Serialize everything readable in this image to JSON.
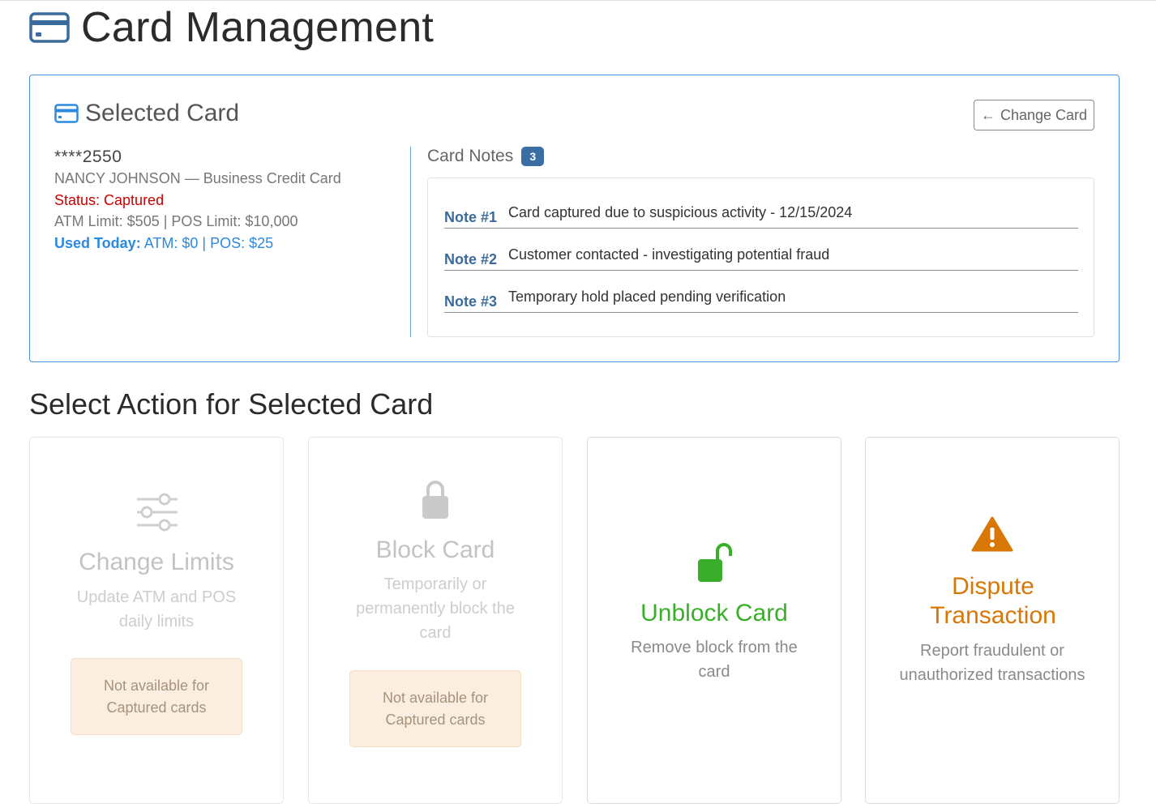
{
  "page": {
    "title": "Card Management"
  },
  "selected_card": {
    "heading": "Selected Card",
    "change_button": "Change Card",
    "card_number": "****2550",
    "holder_line": "NANCY JOHNSON — Business Credit Card",
    "status": "Status: Captured",
    "limits": "ATM Limit: $505 | POS Limit: $10,000",
    "used_today_label": "Used Today:",
    "used_today_value": "ATM: $0 | POS: $25"
  },
  "notes": {
    "heading": "Card Notes",
    "count": "3",
    "items": [
      {
        "label": "Note #1",
        "text": "Card captured due to suspicious activity - 12/15/2024"
      },
      {
        "label": "Note #2",
        "text": "Customer contacted - investigating potential fraud"
      },
      {
        "label": "Note #3",
        "text": "Temporary hold placed pending verification"
      }
    ]
  },
  "actions": {
    "heading": "Select Action for Selected Card",
    "items": [
      {
        "title": "Change Limits",
        "desc": "Update ATM and POS daily limits",
        "unavailable": "Not available for Captured cards"
      },
      {
        "title": "Block Card",
        "desc": "Temporarily or permanently block the card",
        "unavailable": "Not available for Captured cards"
      },
      {
        "title": "Unblock Card",
        "desc": "Remove block from the card"
      },
      {
        "title": "Dispute Transaction",
        "desc": "Report fraudulent or unauthorized transactions"
      }
    ]
  },
  "colors": {
    "panel_border": "#4a90d9",
    "status_red": "#cc0000",
    "used_blue": "#2b8ae0",
    "badge": "#3b6fa3",
    "unblock_green": "#3aae2a",
    "dispute_orange": "#d97706",
    "unavailable_bg": "#fbeee0"
  },
  "icons": {
    "title": "credit-card-icon",
    "panel": "credit-card-icon",
    "change_button": "arrow-left-icon",
    "change_limits": "sliders-icon",
    "block": "lock-icon",
    "unblock": "unlock-icon",
    "dispute": "warning-triangle-icon"
  }
}
